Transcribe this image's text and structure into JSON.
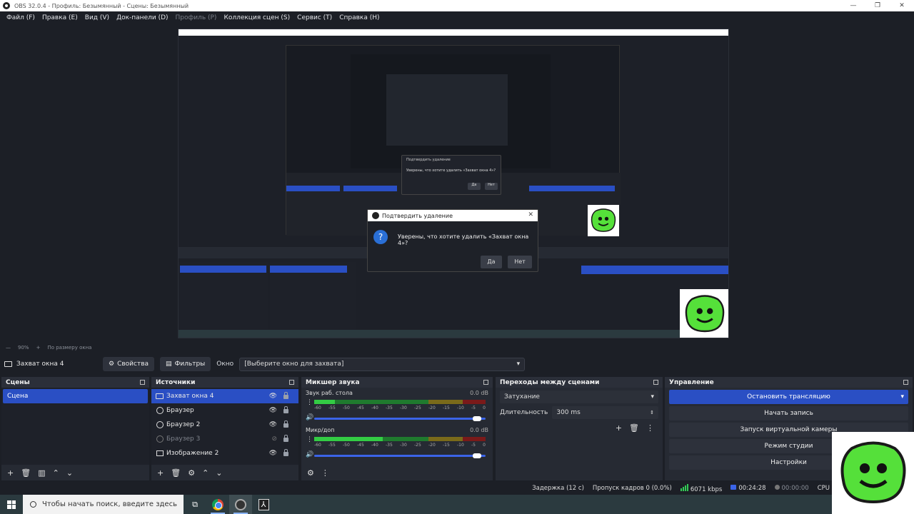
{
  "window": {
    "title": "OBS 32.0.4 - Профиль: Безымянный - Сцены: Безымянный"
  },
  "menu": [
    {
      "label": "Файл (F)",
      "disabled": false
    },
    {
      "label": "Правка (E)",
      "disabled": false
    },
    {
      "label": "Вид (V)",
      "disabled": false
    },
    {
      "label": "Док-панели (D)",
      "disabled": false
    },
    {
      "label": "Профиль (P)",
      "disabled": true
    },
    {
      "label": "Коллекция сцен (S)",
      "disabled": false
    },
    {
      "label": "Сервис (T)",
      "disabled": false
    },
    {
      "label": "Справка (H)",
      "disabled": false
    }
  ],
  "preview": {
    "dialog_title": "Подтвердить удаление",
    "dialog_text": "Уверены, что хотите удалить «Захват окна 4»?",
    "dialog_yes": "Да",
    "dialog_no": "Нет",
    "mini_dialog_text": "Уверены, что хотите удалить «Захват окна 4»?",
    "mini_yes": "Да",
    "mini_no": "Нет"
  },
  "zoom": {
    "value": "90%",
    "mode": "По размеру окна"
  },
  "source_toolbar": {
    "current_source": "Захват окна 4",
    "properties": "Свойства",
    "filters": "Фильтры",
    "window_label": "Окно",
    "window_value": "[Выберите окно для захвата]"
  },
  "scenes": {
    "title": "Сцены",
    "items": [
      "Сцена"
    ]
  },
  "sources": {
    "title": "Источники",
    "items": [
      {
        "label": "Захват окна 4",
        "icon": "monitor-icon",
        "selected": true,
        "hidden": false
      },
      {
        "label": "Браузер",
        "icon": "globe-icon",
        "selected": false,
        "hidden": false
      },
      {
        "label": "Браузер 2",
        "icon": "globe-icon",
        "selected": false,
        "hidden": false
      },
      {
        "label": "Браузер 3",
        "icon": "globe-icon",
        "selected": false,
        "hidden": true
      },
      {
        "label": "Изображение 2",
        "icon": "image-icon",
        "selected": false,
        "hidden": false
      }
    ]
  },
  "mixer": {
    "title": "Микшер звука",
    "channels": [
      {
        "name": "Звук раб. стола",
        "db": "0.0 dB",
        "level": 0.12,
        "volume": 0.95
      },
      {
        "name": "Микр/доп",
        "db": "0.0 dB",
        "level": 0.4,
        "volume": 0.95
      }
    ],
    "scale": [
      "-60",
      "-55",
      "-50",
      "-45",
      "-40",
      "-35",
      "-30",
      "-25",
      "-20",
      "-15",
      "-10",
      "-5",
      "0"
    ]
  },
  "transitions": {
    "title": "Переходы между сценами",
    "selected": "Затухание",
    "duration_label": "Длительность",
    "duration_value": "300 ms"
  },
  "controls": {
    "title": "Управление",
    "stop_stream": "Остановить трансляцию",
    "start_record": "Начать запись",
    "virtual_cam": "Запуск виртуальной камеры",
    "studio_mode": "Режим студии",
    "settings": "Настройки"
  },
  "status": {
    "delay": "Задержка (12 с)",
    "dropped": "Пропуск кадров 0 (0.0%)",
    "bitrate": "6071 kbps",
    "stream_time": "00:24:28",
    "record_time": "00:00:00",
    "cpu": "CPU"
  },
  "taskbar": {
    "search_placeholder": "Чтобы начать поиск, введите здесь"
  },
  "colors": {
    "accent": "#2a4fc4",
    "meter_green": "#33cc44",
    "sticker_green": "#55e03a"
  }
}
